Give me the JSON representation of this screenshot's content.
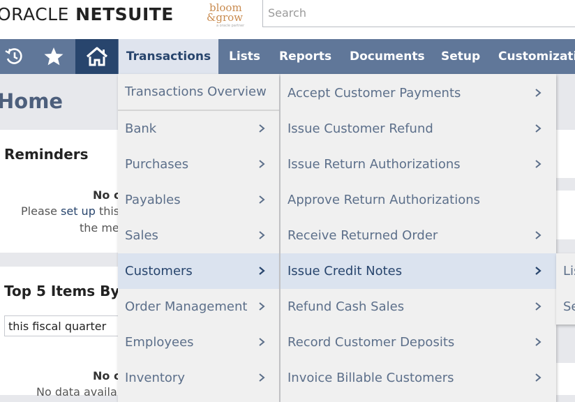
{
  "brand": {
    "logo_light": "ORACLE",
    "logo_bold": " NETSUITE",
    "partner_line1": "bloom",
    "partner_line2": "&grow",
    "partner_tagline": "a oracle partner"
  },
  "search": {
    "placeholder": "Search"
  },
  "nav": {
    "icons": [
      "recent-records-icon",
      "favorites-star-icon",
      "home-icon"
    ],
    "tabs": [
      "Transactions",
      "Lists",
      "Reports",
      "Documents",
      "Setup",
      "Customizatio"
    ],
    "active_tab": "Transactions"
  },
  "page": {
    "title": "Home"
  },
  "reminders": {
    "title": "Reminders",
    "no_text": "No c",
    "line1_pre": "Please ",
    "line1_link": "set up",
    "line1_post": " this",
    "line2": "the me"
  },
  "top5": {
    "title": "Top 5 Items By Q",
    "period": "this fiscal quarter",
    "no_text": "No c",
    "no_data": "No data availab"
  },
  "menu_level1": {
    "items": [
      {
        "label": "Transactions Overview",
        "submenu": false
      },
      {
        "label": "Bank",
        "submenu": true
      },
      {
        "label": "Purchases",
        "submenu": true
      },
      {
        "label": "Payables",
        "submenu": true
      },
      {
        "label": "Sales",
        "submenu": true
      },
      {
        "label": "Customers",
        "submenu": true,
        "highlighted": true
      },
      {
        "label": "Order Management",
        "submenu": true
      },
      {
        "label": "Employees",
        "submenu": true
      },
      {
        "label": "Inventory",
        "submenu": true
      }
    ]
  },
  "menu_level2": {
    "items": [
      {
        "label": "Accept Customer Payments",
        "submenu": true
      },
      {
        "label": "Issue Customer Refund",
        "submenu": true
      },
      {
        "label": "Issue Return Authorizations",
        "submenu": true
      },
      {
        "label": "Approve Return Authorizations",
        "submenu": false
      },
      {
        "label": "Receive Returned Order",
        "submenu": true
      },
      {
        "label": "Issue Credit Notes",
        "submenu": true,
        "highlighted": true
      },
      {
        "label": "Refund Cash Sales",
        "submenu": true
      },
      {
        "label": "Record Customer Deposits",
        "submenu": true
      },
      {
        "label": "Invoice Billable Customers",
        "submenu": true
      }
    ]
  },
  "menu_level3": {
    "items": [
      "Lis",
      "Se"
    ]
  },
  "colors": {
    "nav_bg": "#607799",
    "nav_dark": "#28456d",
    "menu_bg": "#f0f0f0",
    "highlight": "#dbe3ef",
    "menu_text": "#5c6f8a"
  }
}
